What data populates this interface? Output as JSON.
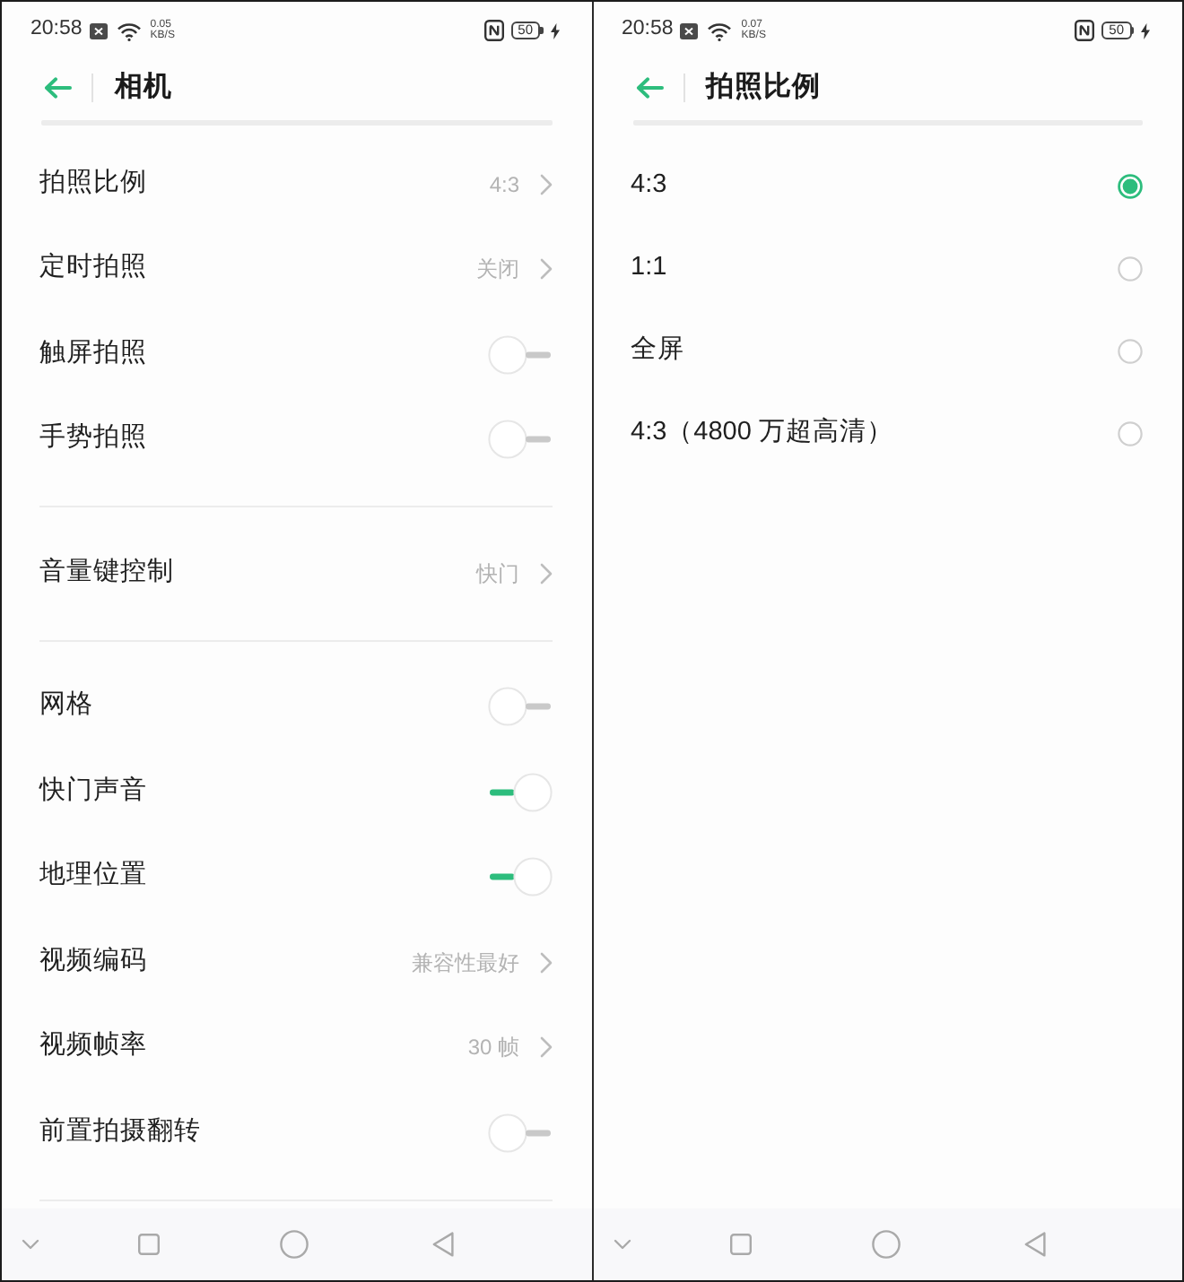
{
  "screens": [
    {
      "kind": "settings",
      "status_bar": {
        "time": "20:58",
        "speed": "0.05",
        "speed_unit": "KB/S",
        "battery": "50"
      },
      "title": "相机",
      "sections": [
        {
          "items": [
            {
              "kind": "link",
              "label": "拍照比例",
              "value": "4:3"
            },
            {
              "kind": "link",
              "label": "定时拍照",
              "value": "关闭"
            },
            {
              "kind": "toggle",
              "label": "触屏拍照",
              "on": false
            },
            {
              "kind": "toggle",
              "label": "手势拍照",
              "on": false
            }
          ]
        },
        {
          "items": [
            {
              "kind": "link",
              "label": "音量键控制",
              "value": "快门"
            }
          ]
        },
        {
          "items": [
            {
              "kind": "toggle",
              "label": "网格",
              "on": false
            },
            {
              "kind": "toggle",
              "label": "快门声音",
              "on": true
            },
            {
              "kind": "toggle",
              "label": "地理位置",
              "on": true
            },
            {
              "kind": "link",
              "label": "视频编码",
              "value": "兼容性最好"
            },
            {
              "kind": "link",
              "label": "视频帧率",
              "value": "30 帧"
            },
            {
              "kind": "toggle",
              "label": "前置拍摄翻转",
              "on": false
            }
          ]
        }
      ]
    },
    {
      "kind": "choice",
      "status_bar": {
        "time": "20:58",
        "speed": "0.07",
        "speed_unit": "KB/S",
        "battery": "50"
      },
      "title": "拍照比例",
      "options": [
        {
          "label": "4:3",
          "selected": true
        },
        {
          "label": "1:1",
          "selected": false
        },
        {
          "label": "全屏",
          "selected": false
        },
        {
          "label": "4:3（4800 万超高清）",
          "selected": false
        }
      ]
    }
  ]
}
